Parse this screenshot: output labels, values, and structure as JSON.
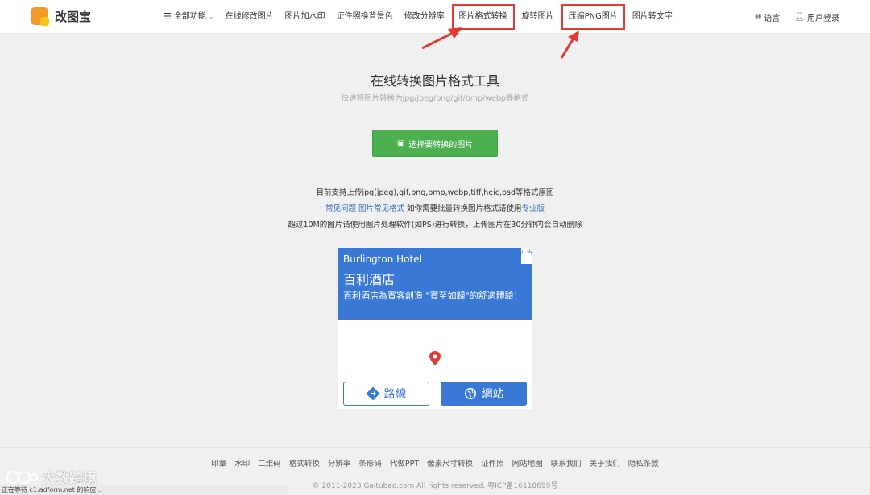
{
  "header": {
    "logo_text": "改图宝",
    "nav": [
      {
        "label": "全部功能"
      },
      {
        "label": "在线修改图片"
      },
      {
        "label": "图片加水印"
      },
      {
        "label": "证件照换背景色"
      },
      {
        "label": "修改分辨率"
      },
      {
        "label": "图片格式转换"
      },
      {
        "label": "旋转图片"
      },
      {
        "label": "压缩PNG图片"
      },
      {
        "label": "图片转文字"
      }
    ],
    "language": "语言",
    "login": "用户登录"
  },
  "main": {
    "title": "在线转换图片格式工具",
    "subtitle": "快速将图片转换为jpg/jpeg/png/gif/bmp/webp等格式",
    "upload_button": "选择要转换的图片",
    "support_text": "目前支持上传jpg(jpeg),gif,png,bmp,webp,tiff,heic,psd等格式原图",
    "faq_link": "常见问题",
    "faq_image_link": "图片常见格式",
    "batch_text": "如你需要批量转换图片格式请使用",
    "pro_link": "专业版",
    "notice_text": "超过10M的图片请使用图片处理软件(如PS)进行转换，上传图片在30分钟内会自动删除"
  },
  "ad": {
    "hotel_name": "Burlington Hotel",
    "hotel_cn": "百利酒店",
    "description": "百利酒店為賓客創造 \"賓至如歸\"的舒適體驗！",
    "route_button": "路線",
    "site_button": "網站",
    "adchoice": "广告"
  },
  "footer": {
    "links": [
      "印章",
      "水印",
      "二维码",
      "格式转换",
      "分辨率",
      "条形码",
      "代做PPT",
      "像素尺寸转换",
      "证件照",
      "网站地图",
      "联系我们",
      "关于我们",
      "隐私条款"
    ],
    "copyright": "© 2011-2023 Gaitubao.com All rights reserved. 粤ICP备16110699号"
  },
  "status_bar": "正在等待 c1.adform.net 的响应...",
  "watermark": "大数跨境",
  "colors": {
    "accent_green": "#4caf50",
    "highlight_red": "#e53935",
    "ad_blue": "#3a78d6",
    "link_blue": "#2a6bbf"
  }
}
